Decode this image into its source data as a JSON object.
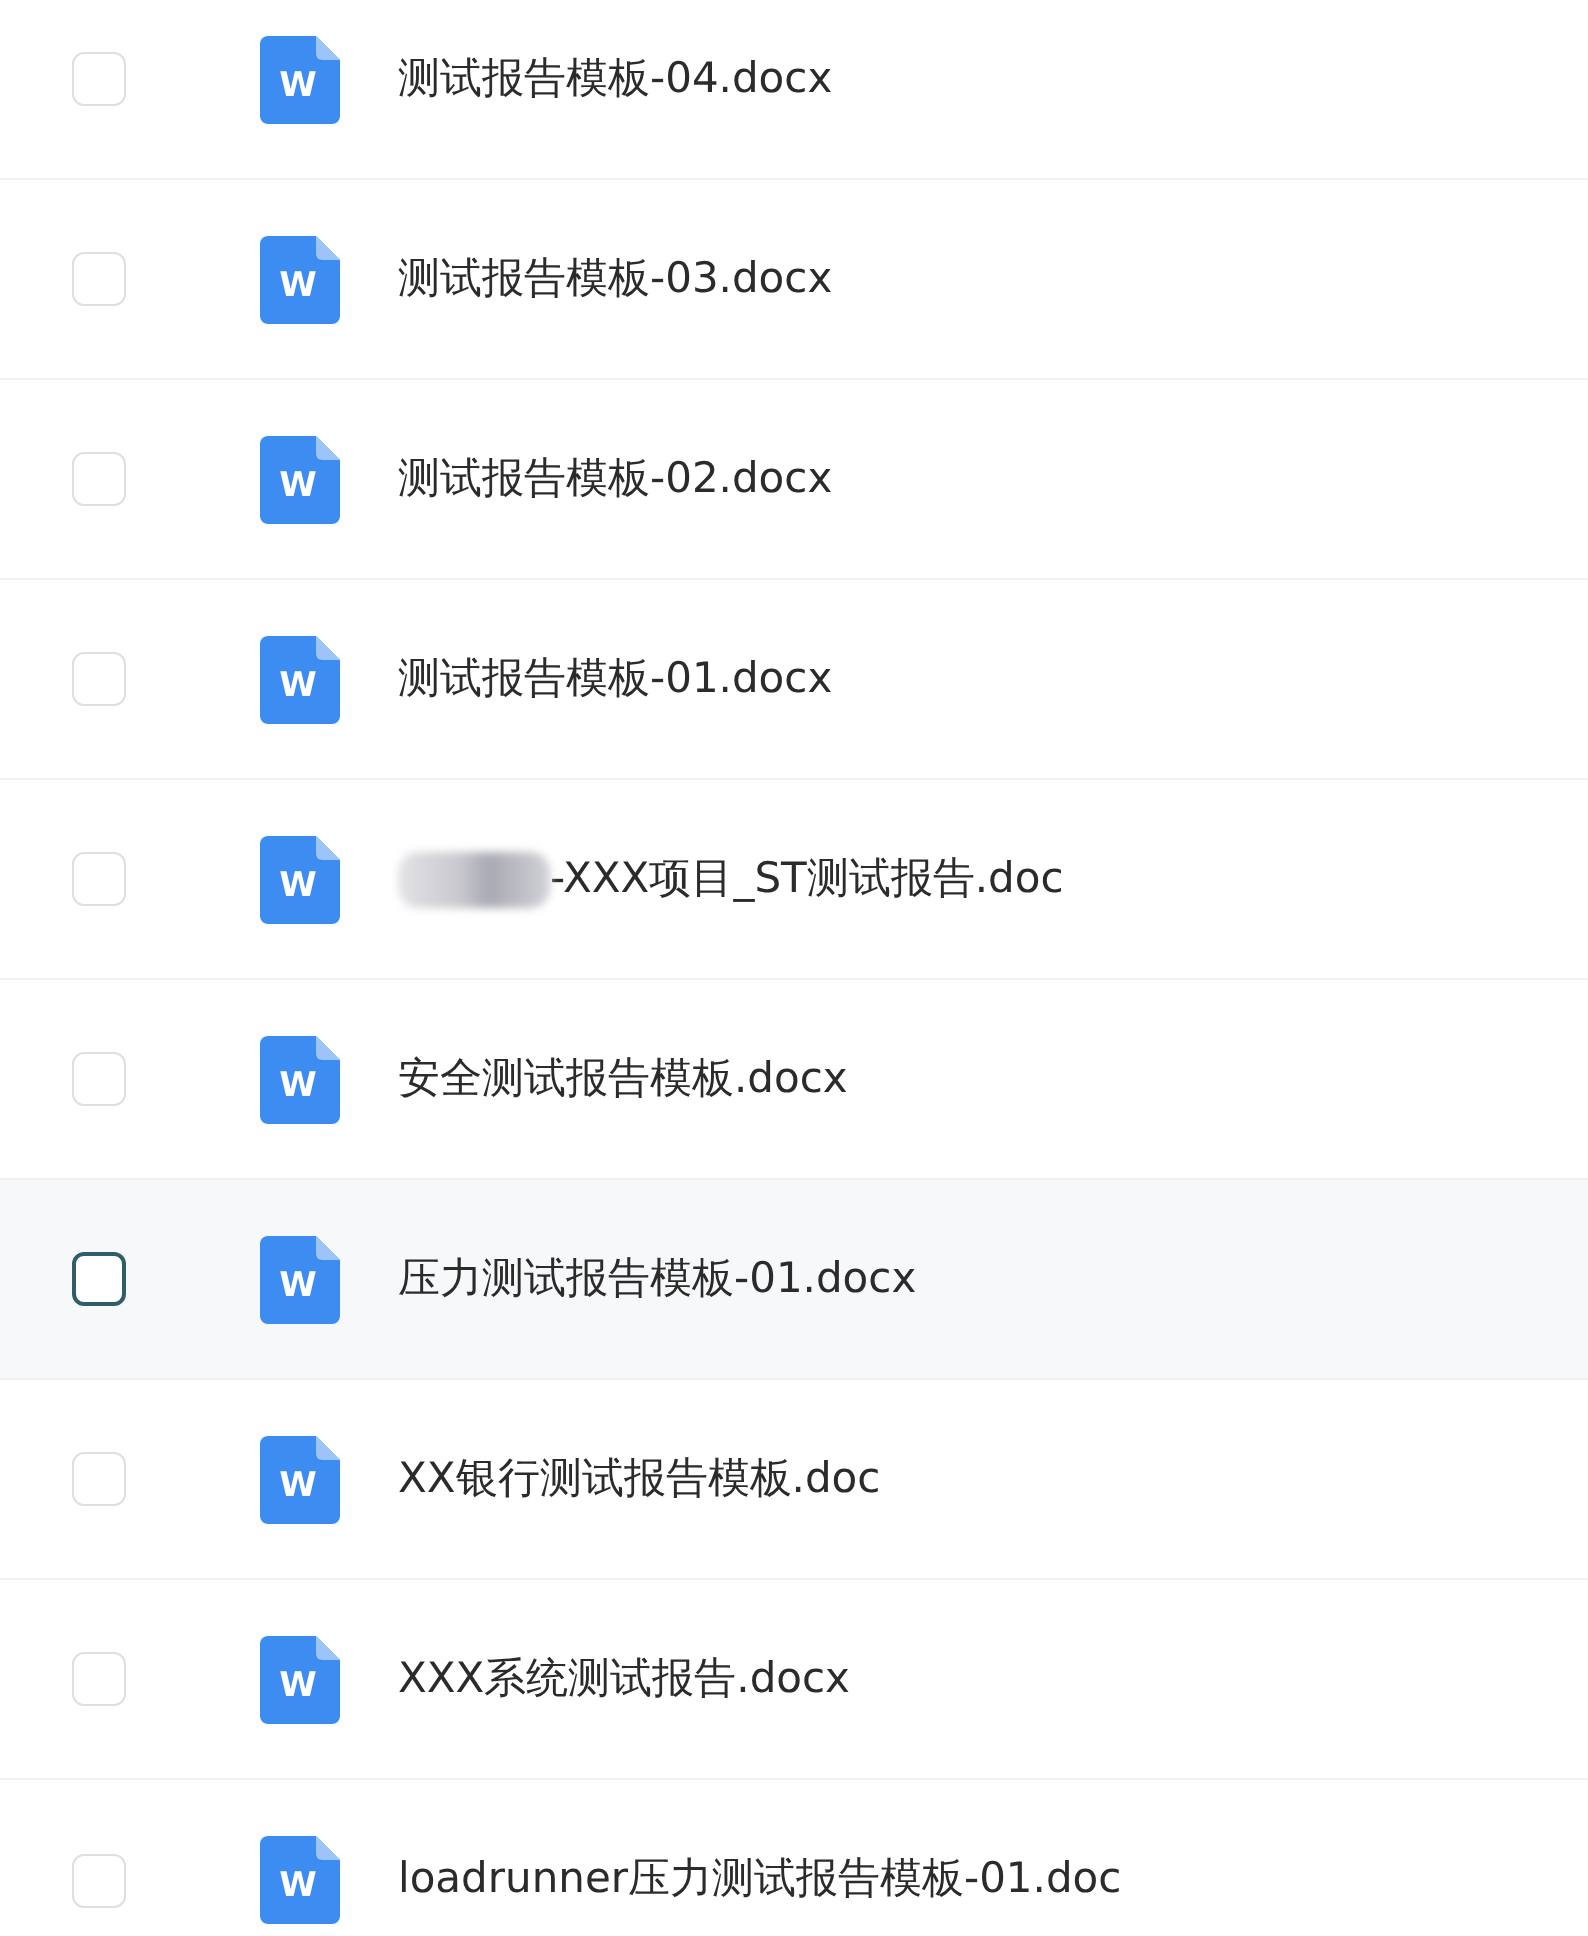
{
  "files": [
    {
      "icon_letter": "W",
      "name": "测试报告模板-04.docx",
      "checked": false,
      "hovered": false,
      "redacted_prefix": false
    },
    {
      "icon_letter": "W",
      "name": "测试报告模板-03.docx",
      "checked": false,
      "hovered": false,
      "redacted_prefix": false
    },
    {
      "icon_letter": "W",
      "name": "测试报告模板-02.docx",
      "checked": false,
      "hovered": false,
      "redacted_prefix": false
    },
    {
      "icon_letter": "W",
      "name": "测试报告模板-01.docx",
      "checked": false,
      "hovered": false,
      "redacted_prefix": false
    },
    {
      "icon_letter": "W",
      "name": "-XXX项目_ST测试报告.doc",
      "checked": false,
      "hovered": false,
      "redacted_prefix": true
    },
    {
      "icon_letter": "W",
      "name": "安全测试报告模板.docx",
      "checked": false,
      "hovered": false,
      "redacted_prefix": false
    },
    {
      "icon_letter": "W",
      "name": "压力测试报告模板-01.docx",
      "checked": false,
      "hovered": true,
      "redacted_prefix": false
    },
    {
      "icon_letter": "W",
      "name": "XX银行测试报告模板.doc",
      "checked": false,
      "hovered": false,
      "redacted_prefix": false
    },
    {
      "icon_letter": "W",
      "name": "XXX系统测试报告.docx",
      "checked": false,
      "hovered": false,
      "redacted_prefix": false
    },
    {
      "icon_letter": "W",
      "name": "loadrunner压力测试报告模板-01.doc",
      "checked": false,
      "hovered": false,
      "redacted_prefix": false
    }
  ]
}
